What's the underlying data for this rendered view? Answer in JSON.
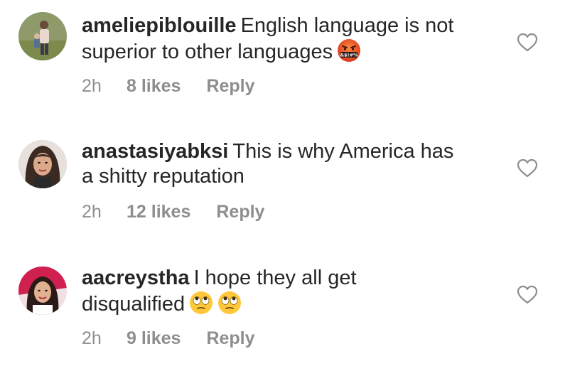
{
  "comments": [
    {
      "username": "ameliepiblouille",
      "text_line1": "English language is not",
      "text_line2": "superior to other languages",
      "emoji": "face-with-symbols-on-mouth-icon",
      "emoji_glyph_text": "&$!#%",
      "time": "2h",
      "likes": "8 likes",
      "reply": "Reply"
    },
    {
      "username": "anastasiyabksi",
      "text_line1": "This is why America has",
      "text_line2": "a shitty reputation",
      "time": "2h",
      "likes": "12 likes",
      "reply": "Reply"
    },
    {
      "username": "aacreystha",
      "text_line1": "I hope they all get",
      "text_line2": "disqualified",
      "emoji": "face-with-rolling-eyes-icon",
      "time": "2h",
      "likes": "9 likes",
      "reply": "Reply"
    }
  ],
  "colors": {
    "text": "#262626",
    "meta": "#8e8e8e",
    "heart": "#8e8e8e"
  }
}
